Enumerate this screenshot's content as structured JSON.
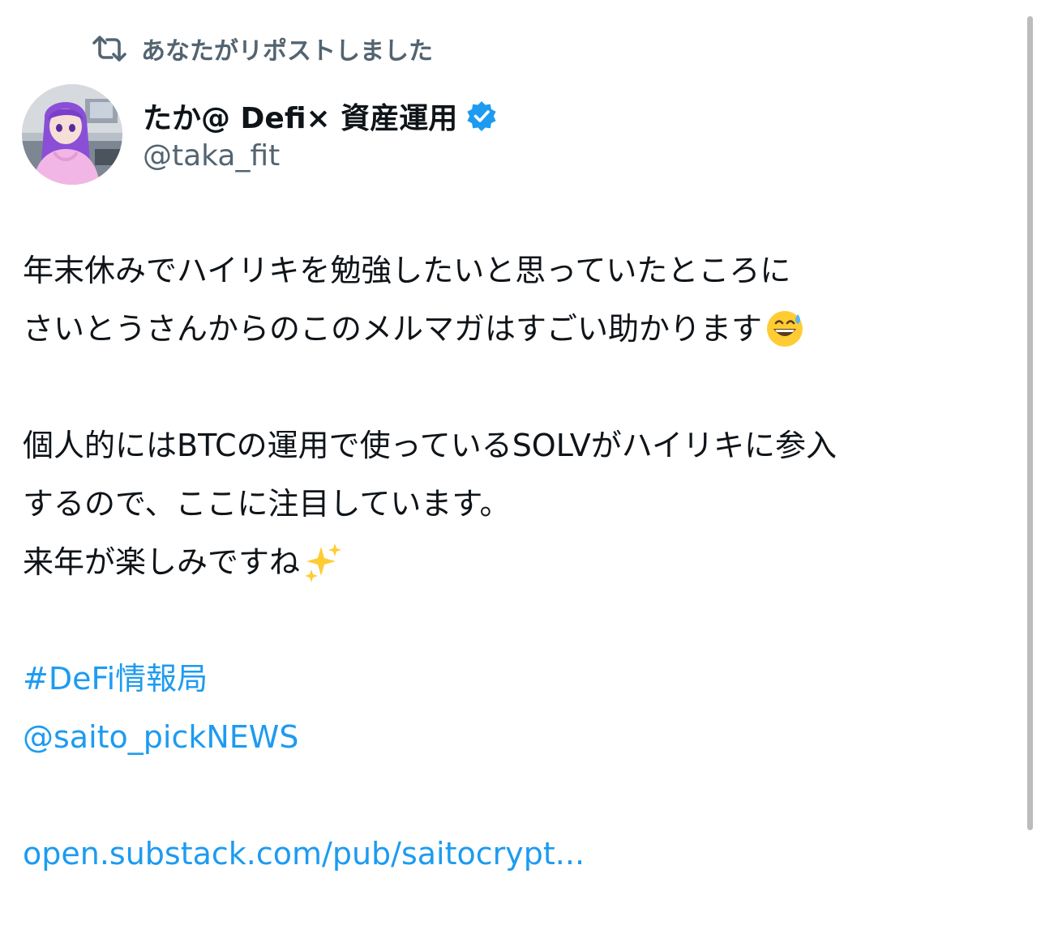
{
  "repost": {
    "label": "あなたがリポストしました",
    "icon": "repost-icon"
  },
  "author": {
    "name": "たか@ Defi× 資産運用",
    "handle": "@taka_fit",
    "verified": true,
    "verified_icon": "verified-badge-icon",
    "avatar": "avatar"
  },
  "tweet": {
    "lines": [
      "年末休みでハイリキを勉強したいと思っていたところに",
      "さいとうさんからのこのメルマガはすごい助かります",
      "",
      "個人的にはBTCの運用で使っているSOLVがハイリキに参入",
      "するので、ここに注目しています。",
      "来年が楽しみですね"
    ],
    "emoji_line2": "grinning-sweat-emoji",
    "emoji_line6": "sparkles-emoji",
    "hashtag": "#DeFi情報局",
    "mention": "@saito_pickNEWS",
    "link": "open.substack.com/pub/saitocrypt..."
  },
  "colors": {
    "link": "#1d9bf0",
    "secondary_text": "#536471",
    "primary_text": "#0f1419",
    "verified": "#1d9bf0"
  }
}
